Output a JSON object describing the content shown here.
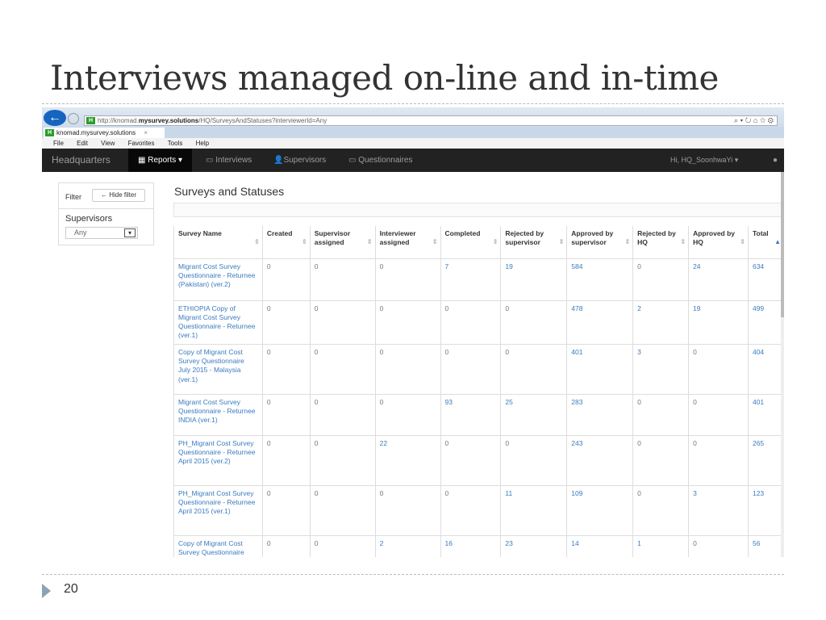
{
  "slide": {
    "title": "Interviews managed on-line and in-time",
    "page_number": "20"
  },
  "browser": {
    "url_host": "http://knomad.",
    "url_bold": "mysurvey.solutions",
    "url_path": "/HQ/SurveysAndStatuses?interviewerId=Any",
    "tab_label": "knomad.mysurvey.solutions",
    "tab_close": "×",
    "site_icon": "H",
    "url_controls": "⌕ ▾ ↻   ⌂ ☆ ⚙",
    "menu": [
      "File",
      "Edit",
      "View",
      "Favorites",
      "Tools",
      "Help"
    ]
  },
  "nav": {
    "brand": "Headquarters",
    "reports": "Reports ▾",
    "interviews": "Interviews",
    "supervisors": "Supervisors",
    "questionnaires": "Questionnaires",
    "user": "Hi, HQ_SoonhwaYi ▾"
  },
  "filter": {
    "label": "Filter",
    "hide_button": "← Hide filter",
    "supervisors_label": "Supervisors",
    "supervisor_value": "Any"
  },
  "page": {
    "heading": "Surveys and Statuses"
  },
  "table": {
    "columns": [
      "Survey Name",
      "Created",
      "Supervisor assigned",
      "Interviewer assigned",
      "Completed",
      "Rejected by supervisor",
      "Approved by supervisor",
      "Rejected by HQ",
      "Approved by HQ",
      "Total"
    ],
    "rows": [
      [
        "Migrant Cost Survey Questionnaire - Returnee (Pakistan) (ver.2)",
        "0",
        "0",
        "0",
        "7",
        "19",
        "584",
        "0",
        "24",
        "634"
      ],
      [
        "ETHIOPIA Copy of Migrant Cost Survey Questionnaire - Returnee (ver.1)",
        "0",
        "0",
        "0",
        "0",
        "0",
        "478",
        "2",
        "19",
        "499"
      ],
      [
        "Copy of Migrant Cost Survey Questionnaire July 2015 - Malaysia (ver.1)",
        "0",
        "0",
        "0",
        "0",
        "0",
        "401",
        "3",
        "0",
        "404"
      ],
      [
        "Migrant Cost Survey Questionnaire - Returnee INDIA (ver.1)",
        "0",
        "0",
        "0",
        "93",
        "25",
        "283",
        "0",
        "0",
        "401"
      ],
      [
        "PH_Migrant Cost Survey Questionnaire - Returnee April 2015 (ver.2)",
        "0",
        "0",
        "22",
        "0",
        "0",
        "243",
        "0",
        "0",
        "265"
      ],
      [
        "PH_Migrant Cost Survey Questionnaire - Returnee April 2015 (ver.1)",
        "0",
        "0",
        "0",
        "0",
        "11",
        "109",
        "0",
        "3",
        "123"
      ],
      [
        "Copy of Migrant Cost Survey Questionnaire",
        "0",
        "0",
        "2",
        "16",
        "23",
        "14",
        "1",
        "0",
        "56"
      ]
    ]
  }
}
